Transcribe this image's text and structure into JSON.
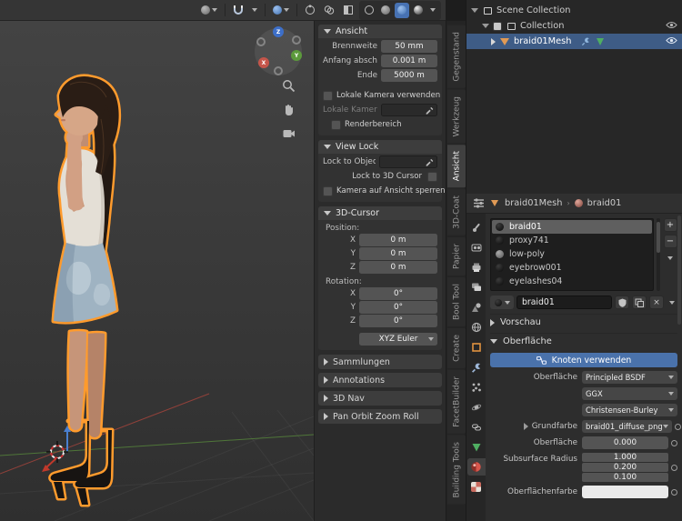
{
  "viewport": {
    "gizmo": {
      "x": "X",
      "y": "Y",
      "z": "Z"
    },
    "accent_color": "#4772b3",
    "selection_outline_color": "#ff9b2d"
  },
  "sidebar": {
    "tabs": [
      {
        "label": "Gegenstand"
      },
      {
        "label": "Werkzeug"
      },
      {
        "label": "Ansicht",
        "active": true
      },
      {
        "label": "3D-Coat"
      },
      {
        "label": "Papier"
      },
      {
        "label": "Bool Tool"
      },
      {
        "label": "Create"
      },
      {
        "label": "FacetBuilder"
      },
      {
        "label": "Building Tools"
      }
    ],
    "view": {
      "title": "Ansicht",
      "rows": [
        {
          "label": "Brennweite",
          "value": "50 mm"
        },
        {
          "label": "Anfang abschne...",
          "value": "0.001 m"
        },
        {
          "label": "Ende",
          "value": "5000 m"
        }
      ],
      "local_camera_toggle": "Lokale Kamera verwenden",
      "local_camera_label": "Lokale Kamera",
      "render_region": "Renderbereich"
    },
    "view_lock": {
      "title": "View Lock",
      "lock_to_object": "Lock to Object",
      "lock_to_cursor": "Lock to 3D Cursor",
      "camera_to_view": "Kamera auf Ansicht sperren"
    },
    "cursor": {
      "title": "3D-Cursor",
      "position_label": "Position:",
      "rotation_label": "Rotation:",
      "position": [
        {
          "axis": "X",
          "value": "0 m"
        },
        {
          "axis": "Y",
          "value": "0 m"
        },
        {
          "axis": "Z",
          "value": "0 m"
        }
      ],
      "rotation": [
        {
          "axis": "X",
          "value": "0°"
        },
        {
          "axis": "Y",
          "value": "0°"
        },
        {
          "axis": "Z",
          "value": "0°"
        }
      ],
      "euler": "XYZ Euler"
    },
    "collapsed": [
      {
        "label": "Sammlungen"
      },
      {
        "label": "Annotations"
      },
      {
        "label": "3D Nav"
      },
      {
        "label": "Pan Orbit Zoom Roll"
      }
    ]
  },
  "outliner": {
    "rows": [
      {
        "label": "Scene Collection"
      },
      {
        "label": "Collection"
      },
      {
        "label": "braid01Mesh",
        "selected": true
      }
    ]
  },
  "properties": {
    "breadcrumb": {
      "object": "braid01Mesh",
      "material": "braid01"
    },
    "slots": [
      {
        "name": "braid01",
        "selected": true
      },
      {
        "name": "proxy741"
      },
      {
        "name": "low-poly"
      },
      {
        "name": "eyebrow001"
      },
      {
        "name": "eyelashes04"
      }
    ],
    "slot_controls": {
      "add": "+",
      "remove": "−"
    },
    "name_field": "braid01",
    "name_controls": {
      "unlink": "×"
    },
    "sections": {
      "preview": "Vorschau",
      "surface": "Oberfläche"
    },
    "use_nodes_label": "Knoten verwenden",
    "fields": {
      "surface_label": "Oberfläche",
      "surface_value": "Principled BSDF",
      "distribution_value": "GGX",
      "sss_method_value": "Christensen-Burley",
      "base_color_label": "Grundfarbe",
      "base_color_value": "braid01_diffuse_png",
      "subsurface_label": "Oberfläche",
      "subsurface_value": "0.000",
      "radius_label": "Subsurface Radius",
      "radius": [
        "1.000",
        "0.200",
        "0.100"
      ],
      "sss_color_label": "Oberflächenfarbe"
    }
  },
  "icons": {
    "magnet-icon": "snapping",
    "eye-icon": "visibility",
    "wrench-icon": "modifiers",
    "eyedropper-icon": "pick object",
    "material-sphere-icon": "material",
    "zoom-icon": "zoom view",
    "hand-icon": "pan view",
    "camera-icon": "camera view"
  }
}
